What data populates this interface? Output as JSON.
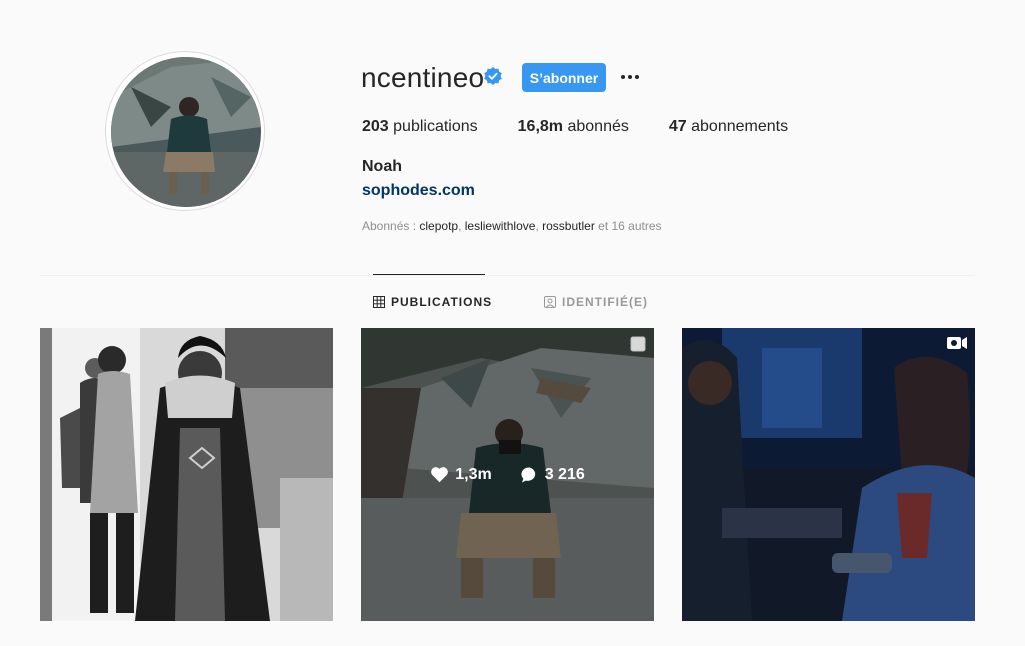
{
  "profile": {
    "username": "ncentineo",
    "follow_label": "S’abonner",
    "fullname": "Noah",
    "website": "sophodes.com",
    "stats": [
      {
        "value": "203",
        "label": "publications"
      },
      {
        "value": "16,8m",
        "label": "abonnés"
      },
      {
        "value": "47",
        "label": "abonnements"
      }
    ],
    "followed_by": {
      "prefix": "Abonnés : ",
      "names": [
        "clepotp",
        "lesliewithlove",
        "rossbutler"
      ],
      "sep": ", ",
      "suffix": " et 16 autres"
    }
  },
  "tabs": [
    {
      "label": "PUBLICATIONS",
      "icon": "grid-icon",
      "active": true
    },
    {
      "label": "IDENTIFIÉ(E)",
      "icon": "tagged-icon",
      "active": false
    }
  ],
  "posts": [
    {
      "id": "post-1",
      "type": "photo"
    },
    {
      "id": "post-2",
      "type": "carousel",
      "likes": "1,3m",
      "comments": "3 216",
      "hovered": true
    },
    {
      "id": "post-3",
      "type": "video"
    }
  ],
  "colors": {
    "accent": "#3897f0",
    "link": "#003569",
    "muted": "#8e8e8e",
    "background": "#fafafa"
  }
}
